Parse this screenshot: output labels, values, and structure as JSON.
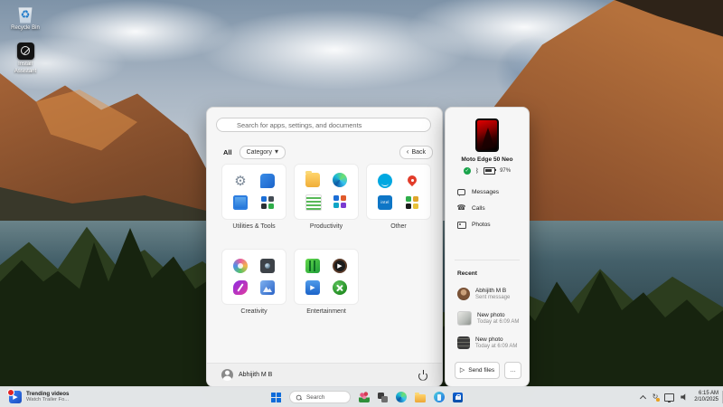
{
  "desktop": {
    "icons": [
      {
        "label": "Recycle Bin"
      },
      {
        "label_line1": "Install",
        "label_line2": "Assistant"
      }
    ]
  },
  "start_menu": {
    "search_placeholder": "Search for apps, settings, and documents",
    "filters": {
      "all": "All",
      "category": "Category",
      "back": "Back"
    },
    "categories": [
      {
        "label": "Utilities & Tools"
      },
      {
        "label": "Productivity"
      },
      {
        "label": "Other"
      },
      {
        "label": "Creativity"
      },
      {
        "label": "Entertainment"
      }
    ],
    "user_name": "Abhijith M B"
  },
  "phone_panel": {
    "device_name": "Moto Edge 50 Neo",
    "battery": "97%",
    "menu": [
      {
        "label": "Messages"
      },
      {
        "label": "Calls"
      },
      {
        "label": "Photos"
      }
    ],
    "recent_header": "Recent",
    "recent": [
      {
        "title": "Abhijith M B",
        "subtitle": "Sent message"
      },
      {
        "title": "New photo",
        "subtitle": "Today at 6:09 AM"
      },
      {
        "title": "New photo",
        "subtitle": "Today at 6:09 AM"
      }
    ],
    "send_files_label": "Send files",
    "more_label": "…"
  },
  "taskbar": {
    "widget": {
      "title": "Trending videos",
      "subtitle": "Watch Trailer Fo..."
    },
    "search_placeholder": "Search",
    "clock": {
      "time": "6:15 AM",
      "date": "2/10/2025"
    }
  },
  "icons": {
    "search": "magnifier",
    "category_dropdown": "chevron-down",
    "back": "chevron-left",
    "power": "power-circle",
    "connected": "green-check",
    "bluetooth": "bluetooth-rune",
    "battery": "battery-horizontal",
    "send": "triangle-right",
    "windows": "four-pane-logo"
  },
  "colors": {
    "accent": "#0f6cda",
    "connected_green": "#18a34a",
    "phone_wallpaper_red": "#c00000",
    "panel_bg": "#f6f6f6"
  }
}
